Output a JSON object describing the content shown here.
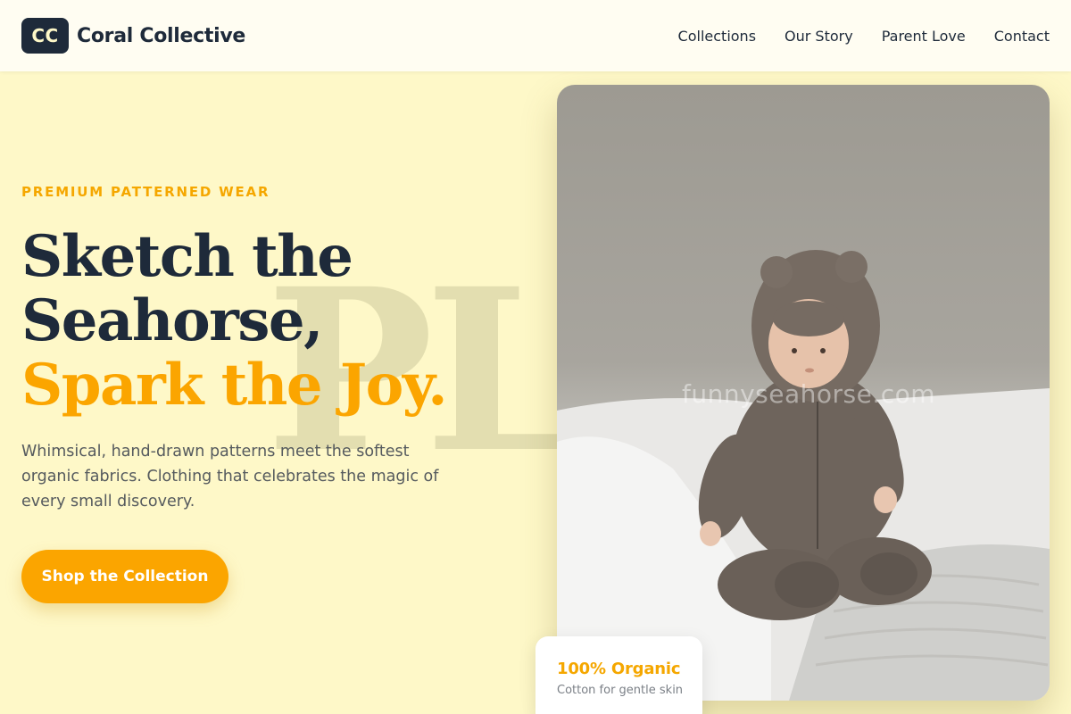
{
  "brand": {
    "logo_initials": "CC",
    "name": "Coral Collective"
  },
  "nav": {
    "items": [
      {
        "label": "Collections"
      },
      {
        "label": "Our Story"
      },
      {
        "label": "Parent Love"
      },
      {
        "label": "Contact"
      }
    ]
  },
  "hero": {
    "eyebrow": "PREMIUM PATTERNED WEAR",
    "headline_line1": "Sketch the",
    "headline_line2": "Seahorse,",
    "headline_accent": "Spark the Joy.",
    "background_word": "PLA",
    "lede": "Whimsical, hand-drawn patterns meet the softest organic fabrics. Clothing that celebrates the magic of every small discovery.",
    "cta_label": "Shop the Collection"
  },
  "photo": {
    "watermark_text": "funnyseahorse.com"
  },
  "badge": {
    "title": "100% Organic",
    "subtitle": "Cotton for gentle skin"
  },
  "colors": {
    "background": "#fef8c8",
    "navy": "#1e2a3a",
    "accent": "#fba500",
    "header": "#fffdf2"
  }
}
